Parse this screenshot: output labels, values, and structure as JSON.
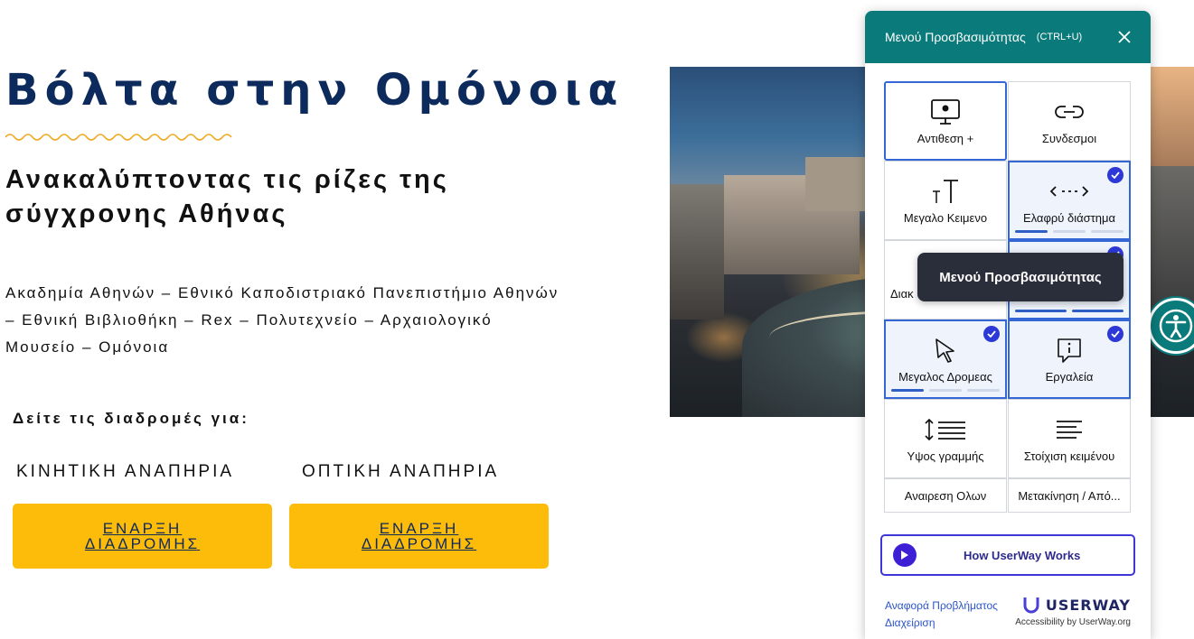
{
  "page": {
    "title": "Βόλτα στην Ομόνοια",
    "subtitle": "Ανακαλύπτοντας τις ρίζες της σύγχρονης Αθήνας",
    "route": "Ακαδημία Αθηνών – Εθνικό Καποδιστριακό Πανεπιστήμιο Αθηνών – Εθνική Βιβλιοθήκη – Rex – Πολυτεχνείο – Αρχαιολογικό Μουσείο – Ομόνοια",
    "see_routes": "Δείτε τις διαδρομές για:",
    "categories": [
      {
        "label": "ΚΙΝΗΤΙΚΗ ΑΝΑΠΗΡΙΑ",
        "button": "ΕΝΑΡΞΗ ΔΙΑΔΡΟΜΗΣ"
      },
      {
        "label": "ΟΠΤΙΚΗ ΑΝΑΠΗΡΙΑ",
        "button": "ΕΝΑΡΞΗ ΔΙΑΔΡΟΜΗΣ"
      }
    ]
  },
  "panel": {
    "title": "Μενού Προσβασιμότητας",
    "shortcut": "(CTRL+U)",
    "tiles": [
      {
        "label": "Αντιθεση +",
        "icon": "monitor-icon",
        "checked": false
      },
      {
        "label": "Συνδεσμοι",
        "icon": "link-icon",
        "checked": false
      },
      {
        "label": "Μεγαλο Κειμενο",
        "icon": "text-size-icon",
        "checked": false
      },
      {
        "label": "Ελαφρύ διάστημα",
        "icon": "spacing-icon",
        "checked": true,
        "level": 1
      },
      {
        "label": "Διακ",
        "icon": "hidden-icon",
        "checked": false
      },
      {
        "label": "",
        "icon": "hidden-icon",
        "checked": true,
        "level": 2
      },
      {
        "label": "Μεγαλος Δρομεας",
        "icon": "cursor-icon",
        "checked": true,
        "level": 1
      },
      {
        "label": "Εργαλεία",
        "icon": "tooltip-icon",
        "checked": true
      },
      {
        "label": "Υψος γραμμής",
        "icon": "line-height-icon",
        "checked": false
      },
      {
        "label": "Στοίχιση κειμένου",
        "icon": "align-icon",
        "checked": false
      }
    ],
    "reset": "Αναιρεση Ολων",
    "move": "Μετακίνηση / Από...",
    "tooltip": "Μενού Προσβασιμότητας",
    "how_works": "How UserWay Works",
    "report": "Αναφορά Προβλήματος",
    "manage": "Διαχείριση",
    "brand": "USERWAY",
    "brand_tag": "Accessibility by UserWay.org",
    "colors": {
      "header": "#0b7a7a",
      "active_border": "#3466d6",
      "check": "#2d39d6",
      "cta": "#fdbb0a"
    }
  }
}
